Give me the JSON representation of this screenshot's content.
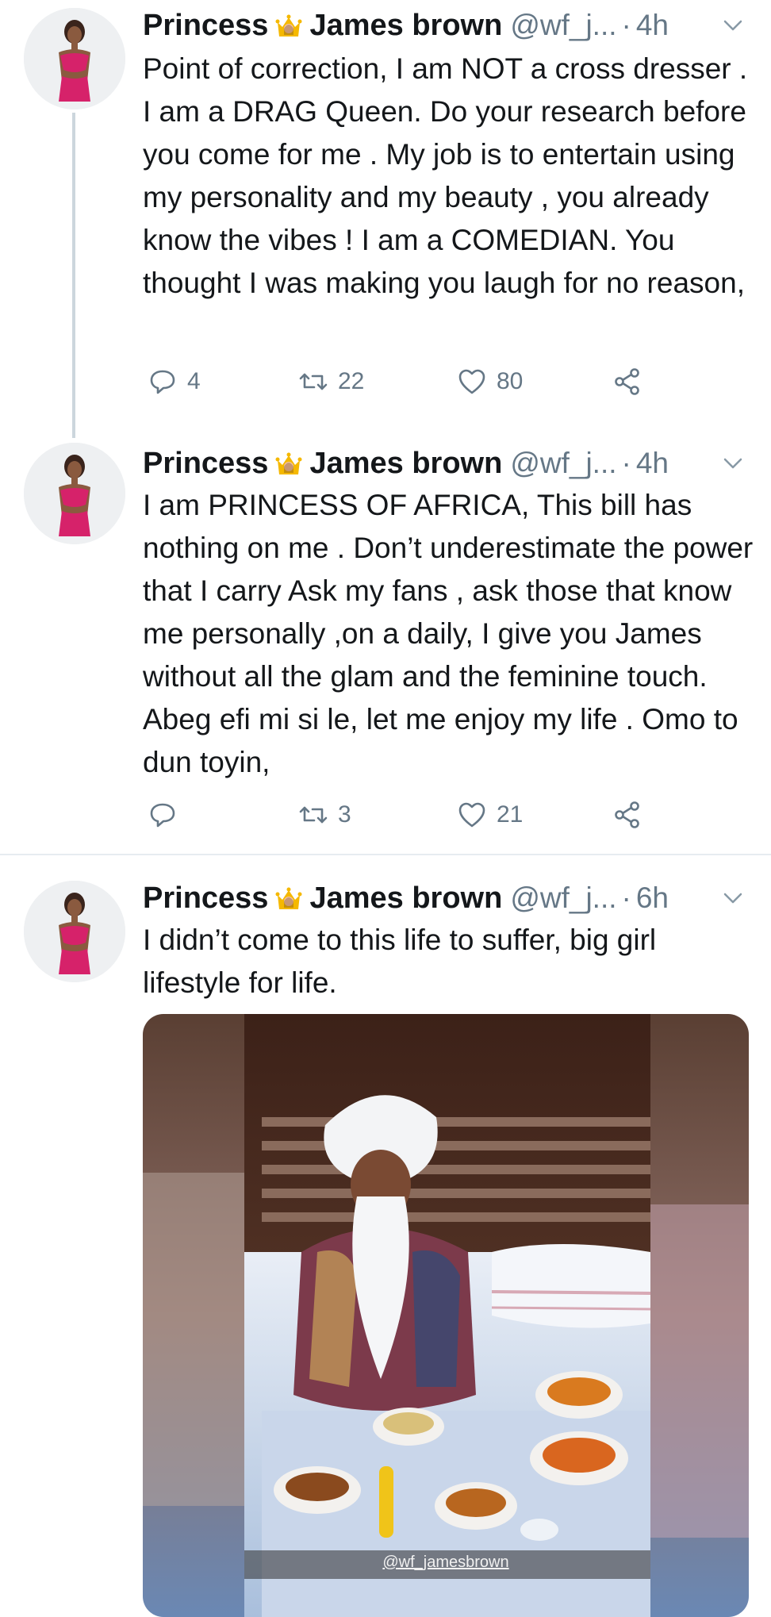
{
  "tweets": [
    {
      "name": "Princess",
      "name2": "James brown",
      "handle": "@wf_j...",
      "dot": "·",
      "time": "4h",
      "text": "Point of correction, I am NOT a cross dresser . I am a DRAG Queen. Do your research before you come for me . My job is to entertain using my personality and my beauty , you already know the vibes ! I am a COMEDIAN. You thought I was making you laugh for no reason,",
      "replies": "4",
      "retweets": "22",
      "likes": "80"
    },
    {
      "name": "Princess",
      "name2": "James brown",
      "handle": "@wf_j...",
      "dot": "·",
      "time": "4h",
      "text": "I am PRINCESS OF AFRICA, This bill has nothing on me . Don’t underestimate the power that I carry Ask my fans , ask those that know me personally ,on a daily, I give you James without all the glam and the feminine touch. Abeg efi mi si le, let me enjoy my life . Omo to dun toyin,",
      "replies": "",
      "retweets": "3",
      "likes": "21"
    },
    {
      "name": "Princess",
      "name2": "James brown",
      "handle": "@wf_j...",
      "dot": "·",
      "time": "6h",
      "text": "I didn’t come to this life to suffer, big girl lifestyle for life.",
      "media_watermark": "@wf_jamesbrown"
    }
  ],
  "icons": {
    "crown": "crown-emoji",
    "reply": "reply-icon",
    "retweet": "retweet-icon",
    "like": "like-icon",
    "share": "share-icon",
    "caret": "chevron-down-icon"
  },
  "colors": {
    "text": "#14171a",
    "muted": "#657786",
    "thread_line": "#ccd6dd",
    "divider": "#e6ecf0",
    "outfit_pink": "#d6226a"
  }
}
